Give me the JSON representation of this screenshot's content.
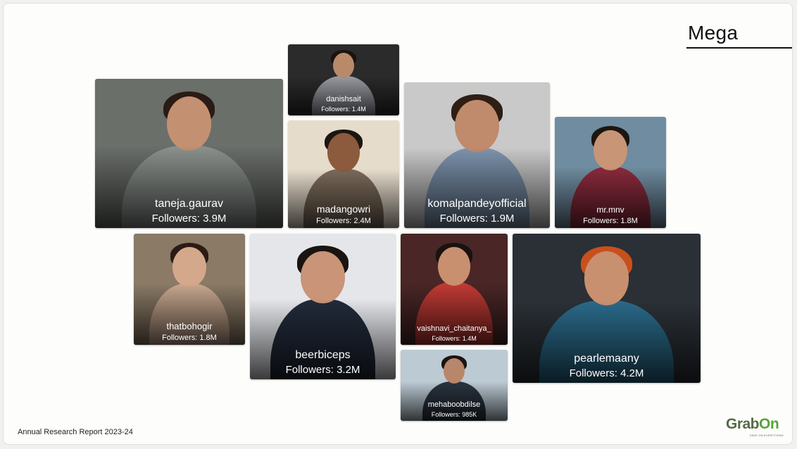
{
  "slide": {
    "title": "Mega",
    "footer": "Annual Research Report 2023-24",
    "logo": {
      "word_start": "Grab",
      "word_end": "On",
      "tagline": "SAVE ON EVERYTHING"
    }
  },
  "influencers": [
    {
      "handle": "danishsait",
      "followers": "Followers: 1.4M",
      "bg": "#2b2b2b",
      "skin": "#b98a6a",
      "shirt": "#9a9ca3",
      "hair": "#1a1410"
    },
    {
      "handle": "taneja.gaurav",
      "followers": "Followers: 3.9M",
      "bg": "#6b6f6a",
      "skin": "#c49072",
      "shirt": "#8c928e",
      "hair": "#2a1c14"
    },
    {
      "handle": "madangowri",
      "followers": "Followers: 2.4M",
      "bg": "#e6dccc",
      "skin": "#8c5a3c",
      "shirt": "#7a6a5a",
      "hair": "#1c1612"
    },
    {
      "handle": "komalpandeyofficial",
      "followers": "Followers: 1.9M",
      "bg": "#c9c9c9",
      "skin": "#c08a6c",
      "shirt": "#7d93ad",
      "hair": "#2e1e14"
    },
    {
      "handle": "mr.mnv",
      "followers": "Followers: 1.8M",
      "bg": "#6f8ca0",
      "skin": "#c89576",
      "shirt": "#8a2a3c",
      "hair": "#1c1612"
    },
    {
      "handle": "thatbohogir",
      "followers": "Followers: 1.8M",
      "bg": "#8a7a66",
      "skin": "#d4a88a",
      "shirt": "#c8a890",
      "hair": "#2a1c14"
    },
    {
      "handle": "beerbiceps",
      "followers": "Followers: 3.2M",
      "bg": "#e4e6ea",
      "skin": "#c99478",
      "shirt": "#222a3a",
      "hair": "#1a1410"
    },
    {
      "handle": "vaishnavi_chaitanya_",
      "followers": "Followers: 1.4M",
      "bg": "#4a2626",
      "skin": "#c8906e",
      "shirt": "#c23a34",
      "hair": "#1a1210"
    },
    {
      "handle": "pearlemaany",
      "followers": "Followers: 4.2M",
      "bg": "#2a3036",
      "skin": "#c99070",
      "shirt": "#2a6a8a",
      "hair": "#c8501c"
    },
    {
      "handle": "mehaboobdilse",
      "followers": "Followers: 985K",
      "bg": "#bccad4",
      "skin": "#b8866a",
      "shirt": "#2a3440",
      "hair": "#1a1410"
    }
  ]
}
